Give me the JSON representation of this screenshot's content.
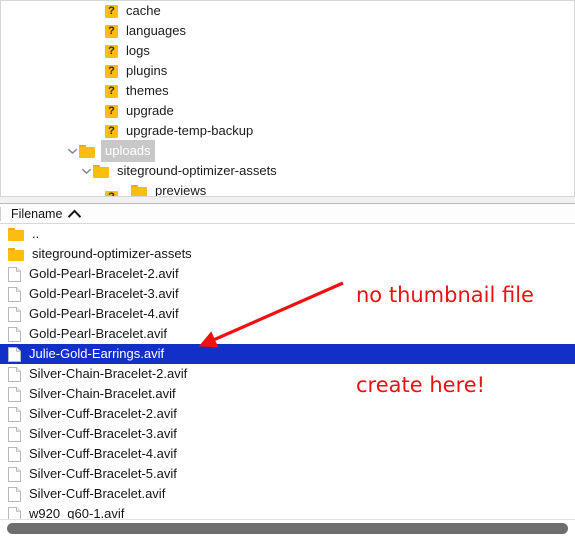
{
  "tree": {
    "name": "directory-tree",
    "items": [
      {
        "label": "cache",
        "icon": "question-folder-icon",
        "indent": 104,
        "twisty": "none",
        "state": "normal"
      },
      {
        "label": "languages",
        "icon": "question-folder-icon",
        "indent": 104,
        "twisty": "none",
        "state": "normal"
      },
      {
        "label": "logs",
        "icon": "question-folder-icon",
        "indent": 104,
        "twisty": "none",
        "state": "normal"
      },
      {
        "label": "plugins",
        "icon": "question-folder-icon",
        "indent": 104,
        "twisty": "none",
        "state": "normal"
      },
      {
        "label": "themes",
        "icon": "question-folder-icon",
        "indent": 104,
        "twisty": "none",
        "state": "normal"
      },
      {
        "label": "upgrade",
        "icon": "question-folder-icon",
        "indent": 104,
        "twisty": "none",
        "state": "normal"
      },
      {
        "label": "upgrade-temp-backup",
        "icon": "question-folder-icon",
        "indent": 104,
        "twisty": "none",
        "state": "normal"
      },
      {
        "label": "uploads",
        "icon": "folder-icon",
        "indent": 78,
        "twisty": "expanded",
        "state": "selected-inactive"
      },
      {
        "label": "siteground-optimizer-assets",
        "icon": "folder-icon",
        "indent": 92,
        "twisty": "expanded",
        "state": "normal"
      },
      {
        "label": "previews",
        "icon": "folder-icon",
        "indent": 130,
        "twisty": "none",
        "state": "normal"
      }
    ],
    "clipped_row": {
      "label": "",
      "icon": "question-folder-icon",
      "indent": 104
    }
  },
  "file_list": {
    "name": "file-list",
    "header": {
      "column_label": "Filename",
      "sort_direction": "ascending",
      "sort_icon": "chevron-up-icon"
    },
    "rows": [
      {
        "label": "..",
        "icon": "folder-icon",
        "selected": false
      },
      {
        "label": "siteground-optimizer-assets",
        "icon": "folder-icon",
        "selected": false
      },
      {
        "label": "Gold-Pearl-Bracelet-2.avif",
        "icon": "file-icon",
        "selected": false
      },
      {
        "label": "Gold-Pearl-Bracelet-3.avif",
        "icon": "file-icon",
        "selected": false
      },
      {
        "label": "Gold-Pearl-Bracelet-4.avif",
        "icon": "file-icon",
        "selected": false
      },
      {
        "label": "Gold-Pearl-Bracelet.avif",
        "icon": "file-icon",
        "selected": false
      },
      {
        "label": "Julie-Gold-Earrings.avif",
        "icon": "file-icon",
        "selected": true
      },
      {
        "label": "Silver-Chain-Bracelet-2.avif",
        "icon": "file-icon",
        "selected": false
      },
      {
        "label": "Silver-Chain-Bracelet.avif",
        "icon": "file-icon",
        "selected": false
      },
      {
        "label": "Silver-Cuff-Bracelet-2.avif",
        "icon": "file-icon",
        "selected": false
      },
      {
        "label": "Silver-Cuff-Bracelet-3.avif",
        "icon": "file-icon",
        "selected": false
      },
      {
        "label": "Silver-Cuff-Bracelet-4.avif",
        "icon": "file-icon",
        "selected": false
      },
      {
        "label": "Silver-Cuff-Bracelet-5.avif",
        "icon": "file-icon",
        "selected": false
      },
      {
        "label": "Silver-Cuff-Bracelet.avif",
        "icon": "file-icon",
        "selected": false
      },
      {
        "label": "w920_q60-1.avif",
        "icon": "file-icon",
        "selected": false
      }
    ]
  },
  "scrollbar": {
    "name": "horizontal-scrollbar",
    "orientation": "horizontal"
  },
  "annotation": {
    "line1": "no thumbnail file",
    "line2": "create here!",
    "color": "#ee1111",
    "arrow": "arrow-pointing-down-left"
  },
  "colors": {
    "selection_blue": "#1230c8",
    "selection_inactive_gray": "#c8c8c8",
    "folder_yellow": "#fbbd10",
    "annotation_red": "#ee1111",
    "scrollbar_thumb": "#6e6e6e"
  }
}
